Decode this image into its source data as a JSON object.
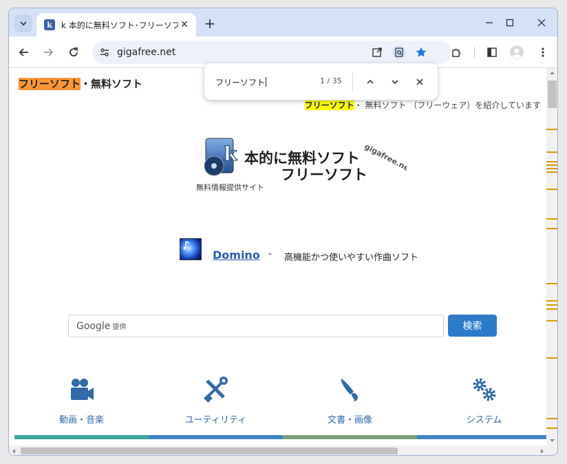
{
  "browser": {
    "tab_title": "k 本的に無料ソフト･フリーソフト",
    "favicon_letter": "k",
    "url": "gigafree.net",
    "accent": "#1a73e8"
  },
  "find_bar": {
    "query": "フリーソフト",
    "count": "1 / 35"
  },
  "page": {
    "site_title_highlight": "フリーソフト",
    "site_title_rest": "・無料ソフト",
    "tagline_highlight": "フリーソフト",
    "tagline_rest": "・ 無料ソフト （フリーウェア）を紹介しています",
    "logo": {
      "line1": "本的に無料ソフト",
      "line2": "フリーソフト",
      "domain": "gigafree.net",
      "subtitle": "無料情報提供サイト"
    },
    "promo": {
      "link": "Domino",
      "dash": "-",
      "desc": "高機能かつ使いやすい作曲ソフト"
    },
    "search": {
      "brand": "Google",
      "brand_suffix": "提供",
      "button": "検索"
    },
    "categories": [
      {
        "label": "動画・音楽",
        "icon": "video-camera-icon",
        "bar_color": "#3aa99f"
      },
      {
        "label": "ユーティリティ",
        "icon": "tools-icon",
        "bar_color": "#3e86c4"
      },
      {
        "label": "文書・画像",
        "icon": "paintbrush-icon",
        "bar_color": "#7aa07a"
      },
      {
        "label": "システム",
        "icon": "gears-icon",
        "bar_color": "#3e86c4"
      }
    ]
  }
}
